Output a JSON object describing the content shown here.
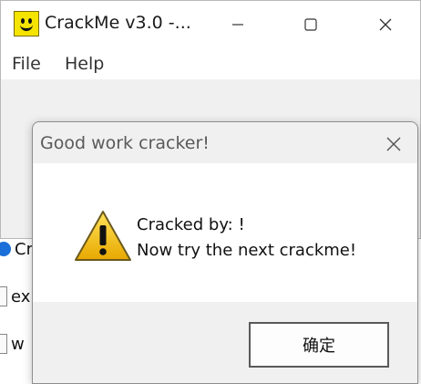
{
  "background": {
    "rows": [
      {
        "text": "Cr",
        "icon": "app-icon-blue"
      },
      {
        "text": "ex",
        "icon": "file-icon"
      },
      {
        "text": "w",
        "icon": "file-icon"
      }
    ]
  },
  "main_window": {
    "title": "CrackMe v3.0  -...",
    "icon": "smiley-icon",
    "menu": [
      "File",
      "Help"
    ]
  },
  "dialog": {
    "title": "Good work cracker!",
    "icon": "warning-icon",
    "message_line1": "Cracked by: !",
    "message_line2": "Now try the next crackme!",
    "ok_label": "确定"
  },
  "colors": {
    "warning_fill": "#f2c100",
    "app_icon": "#f4e400"
  }
}
